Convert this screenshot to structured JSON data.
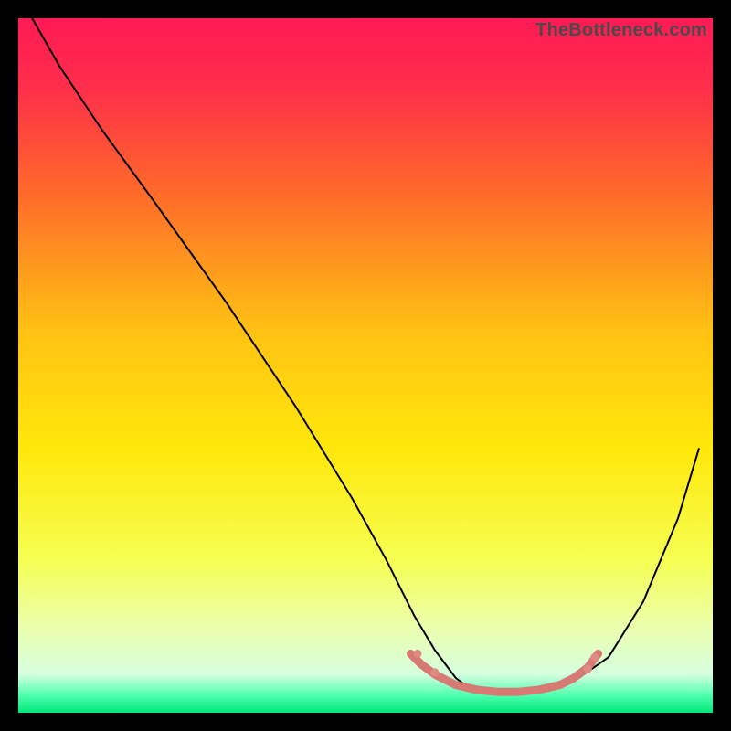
{
  "watermark": "TheBottleneck.com",
  "chart_data": {
    "type": "line",
    "title": "",
    "xlabel": "",
    "ylabel": "",
    "xlim": [
      0,
      100
    ],
    "ylim": [
      0,
      100
    ],
    "gradient_stops": [
      {
        "offset": 0.0,
        "color": "#ff1a55"
      },
      {
        "offset": 0.1,
        "color": "#ff2e4a"
      },
      {
        "offset": 0.25,
        "color": "#ff6a2a"
      },
      {
        "offset": 0.45,
        "color": "#ffc213"
      },
      {
        "offset": 0.62,
        "color": "#ffe80a"
      },
      {
        "offset": 0.78,
        "color": "#f6ff52"
      },
      {
        "offset": 0.88,
        "color": "#eaffb0"
      },
      {
        "offset": 0.945,
        "color": "#d6ffe0"
      },
      {
        "offset": 0.975,
        "color": "#4dffae"
      },
      {
        "offset": 1.0,
        "color": "#00e67a"
      }
    ],
    "series": [
      {
        "name": "bottleneck-curve",
        "stroke": "#000000",
        "stroke_width": 2,
        "x": [
          2,
          6,
          12,
          20,
          30,
          40,
          48,
          53,
          57,
          60,
          63,
          65,
          68,
          71,
          75,
          80,
          85,
          90,
          95,
          98
        ],
        "y": [
          100,
          93,
          84,
          73,
          59,
          44,
          31,
          22,
          14,
          9,
          5,
          3.5,
          3,
          3,
          3.2,
          4.5,
          8,
          16,
          28,
          38
        ]
      },
      {
        "name": "highlight-band",
        "stroke": "#d77a74",
        "stroke_width": 9,
        "x": [
          56.5,
          58,
          60,
          63,
          66,
          69,
          72,
          75,
          78,
          80,
          82,
          83.5
        ],
        "y": [
          8.5,
          7,
          5.5,
          4,
          3.3,
          3,
          3,
          3.3,
          4,
          5,
          6.5,
          8.5
        ]
      }
    ],
    "overlay_dots": {
      "color": "#e08a84",
      "radius": 4.5,
      "points": [
        {
          "x": 57.5,
          "y": 8.5
        },
        {
          "x": 60.0,
          "y": 5.8
        },
        {
          "x": 82.0,
          "y": 6.3
        },
        {
          "x": 83.0,
          "y": 8.0
        }
      ]
    }
  }
}
